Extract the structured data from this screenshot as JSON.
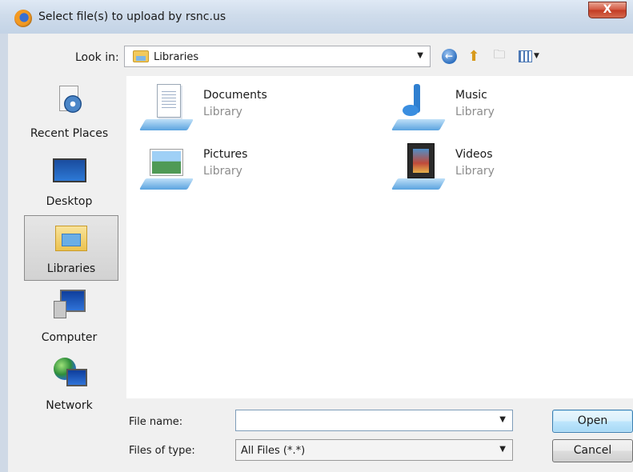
{
  "window": {
    "title": "Select file(s) to upload by rsnc.us",
    "close_label": "X"
  },
  "toolbar": {
    "look_in_label": "Look in:",
    "look_in_value": "Libraries",
    "icons": [
      "back-icon",
      "up-folder-icon",
      "new-folder-icon",
      "views-icon"
    ]
  },
  "places": [
    {
      "label": "Recent Places",
      "icon": "recent-places-icon",
      "selected": false
    },
    {
      "label": "Desktop",
      "icon": "desktop-icon",
      "selected": false
    },
    {
      "label": "Libraries",
      "icon": "libraries-icon",
      "selected": true
    },
    {
      "label": "Computer",
      "icon": "computer-icon",
      "selected": false
    },
    {
      "label": "Network",
      "icon": "network-icon",
      "selected": false
    }
  ],
  "files": [
    {
      "name": "Documents",
      "type": "Library",
      "icon": "documents-library-icon"
    },
    {
      "name": "Music",
      "type": "Library",
      "icon": "music-library-icon"
    },
    {
      "name": "Pictures",
      "type": "Library",
      "icon": "pictures-library-icon"
    },
    {
      "name": "Videos",
      "type": "Library",
      "icon": "videos-library-icon"
    }
  ],
  "bottom": {
    "file_name_label": "File name:",
    "file_name_value": "",
    "files_of_type_label": "Files of type:",
    "files_of_type_value": "All Files (*.*)",
    "open_label": "Open",
    "cancel_label": "Cancel"
  }
}
